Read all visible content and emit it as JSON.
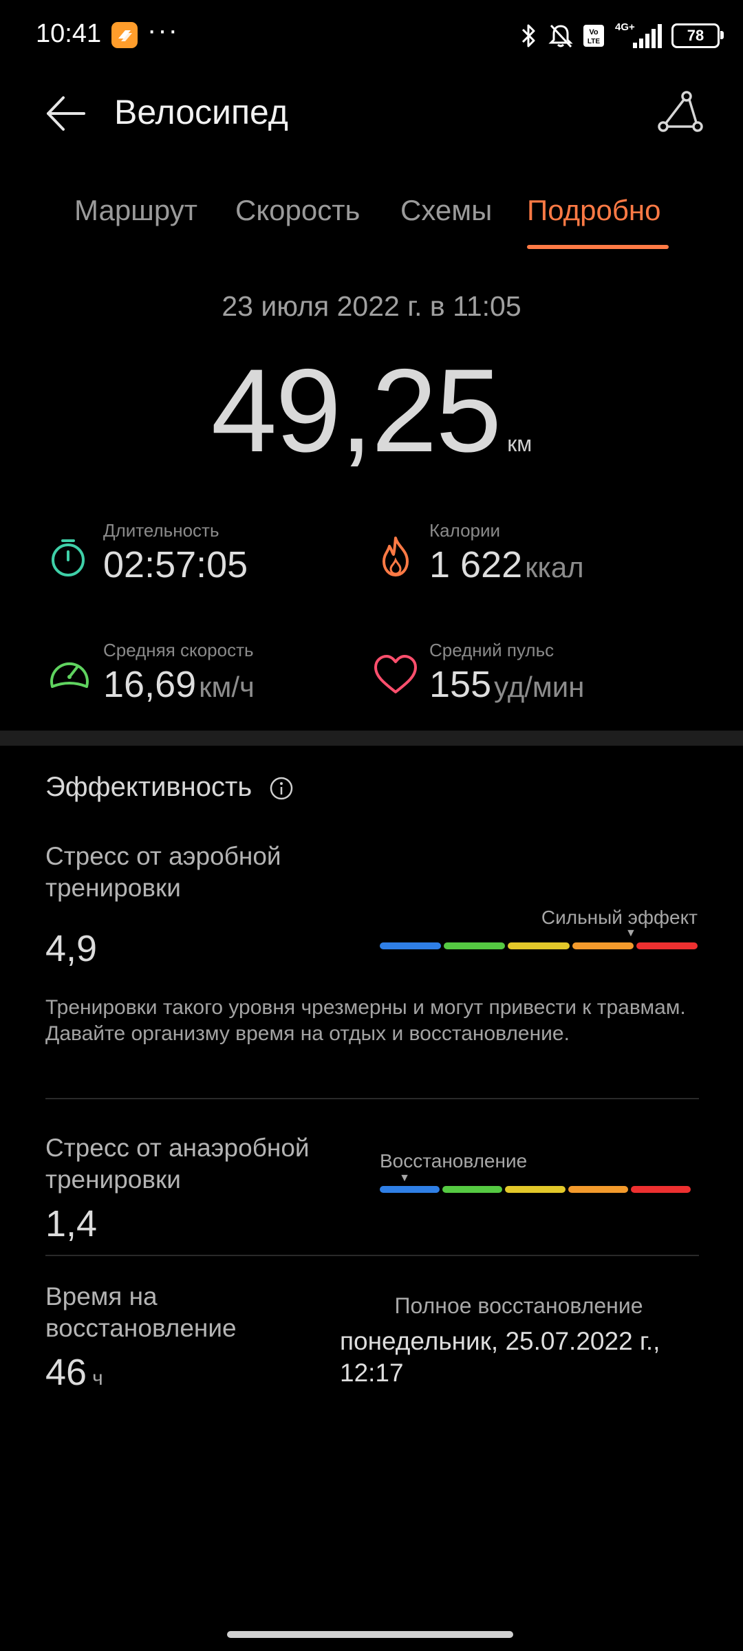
{
  "status_bar": {
    "time": "10:41",
    "dots": "···",
    "icons": [
      "app-notification-icon",
      "bluetooth-icon",
      "bell-off-icon",
      "volte-icon",
      "signal-4g-icon"
    ],
    "volte_label": "Vo LTE",
    "network_label": "4G+",
    "battery": "78"
  },
  "header": {
    "title": "Велосипед",
    "back_icon": "arrow-left-icon",
    "route_icon": "route-icon"
  },
  "tabs": [
    {
      "label": "Маршрут",
      "active": false
    },
    {
      "label": "Скорость",
      "active": false
    },
    {
      "label": "Схемы",
      "active": false
    },
    {
      "label": "Подробно",
      "active": true
    }
  ],
  "summary": {
    "date": "23 июля 2022 г. в 11:05",
    "distance": "49,25",
    "distance_unit": "км"
  },
  "stats": {
    "duration": {
      "label": "Длительность",
      "value": "02:57:05",
      "unit": "",
      "icon": "stopwatch-icon",
      "color": "#3fd0a8"
    },
    "calories": {
      "label": "Калории",
      "value": "1 622",
      "unit": "ккал",
      "icon": "flame-icon",
      "color": "#ff7a45"
    },
    "avg_speed": {
      "label": "Средняя скорость",
      "value": "16,69",
      "unit": "км/ч",
      "icon": "speedometer-icon",
      "color": "#5fd35f"
    },
    "avg_pulse": {
      "label": "Средний пульс",
      "value": "155",
      "unit": "уд/мин",
      "icon": "heart-icon",
      "color": "#ff4f6d"
    }
  },
  "effectiveness": {
    "title": "Эффективность",
    "aerobic": {
      "title_line1": "Стресс от аэробной",
      "title_line2": "тренировки",
      "value": "4,9",
      "bar_label": "Сильный эффект",
      "level": 0.79,
      "description": "Тренировки такого уровня чрезмерны и могут привести к травмам. Давайте организму время на отдых и восстановление."
    },
    "anaerobic": {
      "title_line1": "Стресс от анаэробной",
      "title_line2": "тренировки",
      "value": "1,4",
      "bar_label": "Восстановление",
      "level": 0.08
    },
    "recovery": {
      "title_line1": "Время на",
      "title_line2": "восстановление",
      "value": "46",
      "unit": "ч",
      "caption": "Полное восстановление",
      "date_line1": "понедельник, 25.07.2022 г.,",
      "date_line2": "12:17"
    },
    "bar_colors": [
      "#2f7fe6",
      "#55c942",
      "#e3c82a",
      "#f39a2c",
      "#ee3030"
    ]
  }
}
